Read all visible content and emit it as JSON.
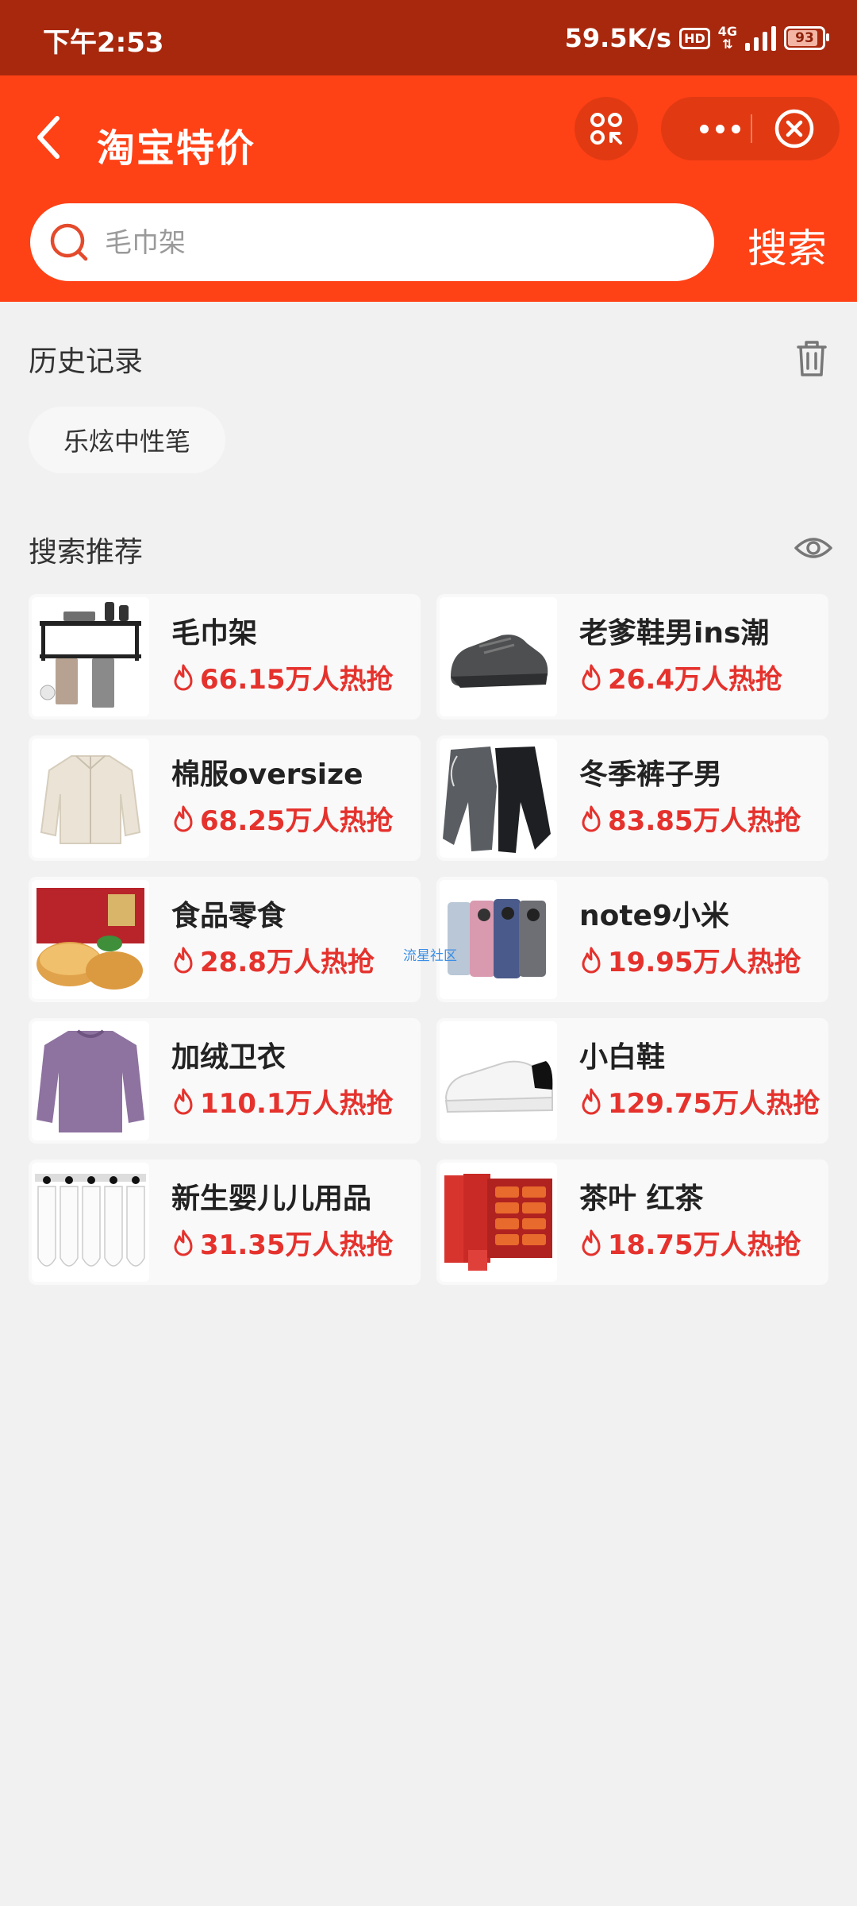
{
  "status_bar": {
    "time": "下午2:53",
    "speed": "59.5K/s",
    "hd": "HD",
    "network": "4G",
    "battery": "93"
  },
  "nav": {
    "title": "淘宝特价"
  },
  "search": {
    "placeholder": "毛巾架",
    "button_label": "搜索"
  },
  "history": {
    "title": "历史记录",
    "items": [
      "乐炫中性笔"
    ]
  },
  "recommend": {
    "title": "搜索推荐",
    "items": [
      {
        "name": "毛巾架",
        "heat": "66.15万人热抢",
        "thumb": "towel-rack"
      },
      {
        "name": "老爹鞋男ins潮",
        "heat": "26.4万人热抢",
        "thumb": "dad-shoe"
      },
      {
        "name": "棉服oversize",
        "heat": "68.25万人热抢",
        "thumb": "cotton-jacket"
      },
      {
        "name": "冬季裤子男",
        "heat": "83.85万人热抢",
        "thumb": "winter-pants"
      },
      {
        "name": "食品零食",
        "heat": "28.8万人热抢",
        "thumb": "snack-food"
      },
      {
        "name": "note9小米",
        "heat": "19.95万人热抢",
        "thumb": "phones"
      },
      {
        "name": "加绒卫衣",
        "heat": "110.1万人热抢",
        "thumb": "sweatshirt"
      },
      {
        "name": "小白鞋",
        "heat": "129.75万人热抢",
        "thumb": "white-shoe"
      },
      {
        "name": "新生婴儿儿用品",
        "heat": "31.35万人热抢",
        "thumb": "baby-towels"
      },
      {
        "name": "茶叶 红茶",
        "heat": "18.75万人热抢",
        "thumb": "tea-box"
      }
    ]
  },
  "watermark": "流星社区",
  "colors": {
    "status_bar": "#a8280d",
    "nav": "#ff4116",
    "heat_text": "#e5322d",
    "background": "#f1f1f1"
  }
}
